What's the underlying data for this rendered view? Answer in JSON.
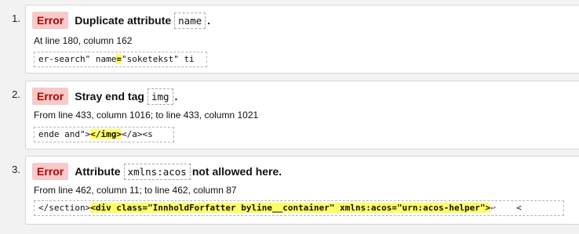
{
  "messages": [
    {
      "number": "1.",
      "type": "Error",
      "text_before": "Duplicate attribute",
      "code": "name",
      "text_after": ".",
      "location": "At line 180, column 162",
      "extract_before": "er-search\" name",
      "extract_highlight": "=",
      "extract_after": "\"soketekst\" ti"
    },
    {
      "number": "2.",
      "type": "Error",
      "text_before": "Stray end tag",
      "code": "img",
      "text_after": ".",
      "location": "From line 433, column 1016; to line 433, column 1021",
      "extract_before": "ende and\">",
      "extract_highlight": "</img>",
      "extract_after": "</a><s"
    },
    {
      "number": "3.",
      "type": "Error",
      "text_before": "Attribute",
      "code": "xmlns:acos",
      "text_after": "not allowed here.",
      "location": "From line 462, column 11; to line 462, column 87",
      "extract_before": "</section>",
      "extract_highlight": "<div class=\"InnholdForfatter byline__container\" xmlns:acos=\"urn:acos-helper\">",
      "extract_return": "↩",
      "extract_after": "    <"
    }
  ]
}
